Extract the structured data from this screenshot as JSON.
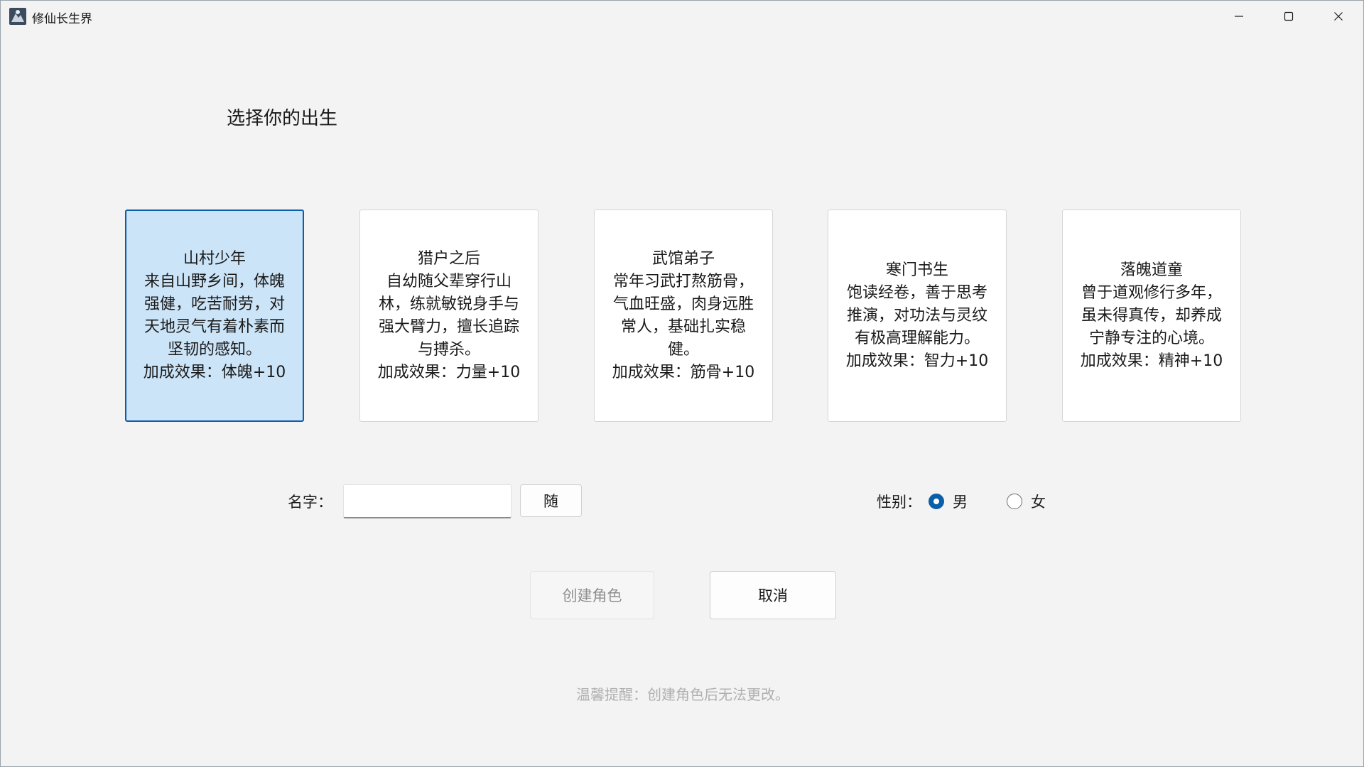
{
  "window": {
    "title": "修仙长生界"
  },
  "heading": "选择你的出生",
  "cards": [
    {
      "title": "山村少年",
      "desc": "来自山野乡间，体魄强健，吃苦耐劳，对天地灵气有着朴素而坚韧的感知。",
      "bonus": "加成效果：体魄+10",
      "selected": true
    },
    {
      "title": "猎户之后",
      "desc": "自幼随父辈穿行山林，练就敏锐身手与强大臂力，擅长追踪与搏杀。",
      "bonus": "加成效果：力量+10",
      "selected": false
    },
    {
      "title": "武馆弟子",
      "desc": "常年习武打熬筋骨，气血旺盛，肉身远胜常人，基础扎实稳健。",
      "bonus": "加成效果：筋骨+10",
      "selected": false
    },
    {
      "title": "寒门书生",
      "desc": "饱读经卷，善于思考推演，对功法与灵纹有极高理解能力。",
      "bonus": "加成效果：智力+10",
      "selected": false
    },
    {
      "title": "落魄道童",
      "desc": "曾于道观修行多年，虽未得真传，却养成宁静专注的心境。",
      "bonus": "加成效果：精神+10",
      "selected": false
    }
  ],
  "form": {
    "name_label": "名字：",
    "name_value": "",
    "random_label": "随",
    "gender_label": "性别：",
    "gender_options": [
      "男",
      "女"
    ],
    "gender_selected": "男"
  },
  "buttons": {
    "create": "创建角色",
    "cancel": "取消"
  },
  "tip": "温馨提醒：创建角色后无法更改。",
  "colors": {
    "accent": "#0a5fa8",
    "selected_card_bg": "#cce4f7"
  }
}
